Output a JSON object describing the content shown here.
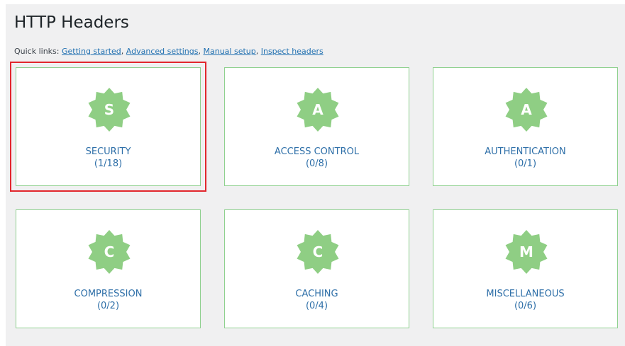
{
  "header": {
    "title": "HTTP Headers"
  },
  "quick_links": {
    "prefix": "Quick links: ",
    "items": [
      {
        "label": "Getting started"
      },
      {
        "label": "Advanced settings"
      },
      {
        "label": "Manual setup"
      },
      {
        "label": "Inspect headers"
      }
    ],
    "link_color": "#2271b1"
  },
  "cards": [
    {
      "letter": "S",
      "label": "SECURITY",
      "count": "(1/18)",
      "selected": true
    },
    {
      "letter": "A",
      "label": "ACCESS CONTROL",
      "count": "(0/8)",
      "selected": false
    },
    {
      "letter": "A",
      "label": "AUTHENTICATION",
      "count": "(0/1)",
      "selected": false
    },
    {
      "letter": "C",
      "label": "COMPRESSION",
      "count": "(0/2)",
      "selected": false
    },
    {
      "letter": "C",
      "label": "CACHING",
      "count": "(0/4)",
      "selected": false
    },
    {
      "letter": "M",
      "label": "MISCELLANEOUS",
      "count": "(0/6)",
      "selected": false
    }
  ],
  "colors": {
    "badge": "#8fce84",
    "card_border": "#8fd18f",
    "label": "#2e6fa8",
    "selection": "#e2262d",
    "background": "#f0f0f1"
  }
}
